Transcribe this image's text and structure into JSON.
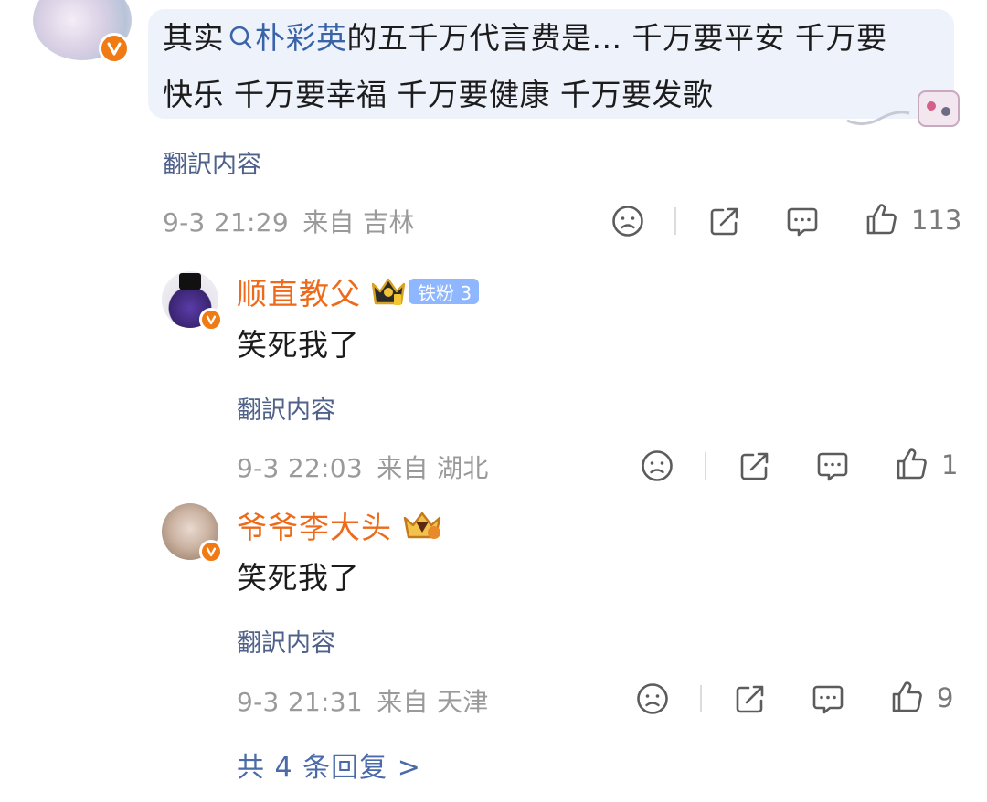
{
  "top_comment": {
    "text_before": "其实",
    "mention": "朴彩英",
    "line1_after": "的五千万代言费是... 千万要平安 千万要",
    "line2": "快乐 千万要幸福 千万要健康 千万要发歌",
    "translate": "翻訳内容",
    "time": "9-3 21:29",
    "location": "来自 吉林",
    "likes": "113"
  },
  "replies": [
    {
      "name": "顺直教父",
      "fan_badge": "铁粉 3",
      "text": "笑死我了",
      "translate": "翻訳内容",
      "time": "9-3 22:03",
      "location": "来自 湖北",
      "likes": "1"
    },
    {
      "name": "爷爷李大头",
      "text": "笑死我了",
      "translate": "翻訳内容",
      "time": "9-3 21:31",
      "location": "来自 天津",
      "likes": "9"
    }
  ],
  "more_replies": "共 4 条回复 >",
  "colors": {
    "accent_orange": "#ee6a1a",
    "link_blue": "#3a64a8",
    "bubble_bg": "#eef2fb",
    "fan_badge_bg": "#8fb7ff"
  },
  "icons": [
    "sad-face-icon",
    "share-icon",
    "comment-icon",
    "thumbs-up-icon",
    "search-icon",
    "crown-icon",
    "verified-icon"
  ]
}
